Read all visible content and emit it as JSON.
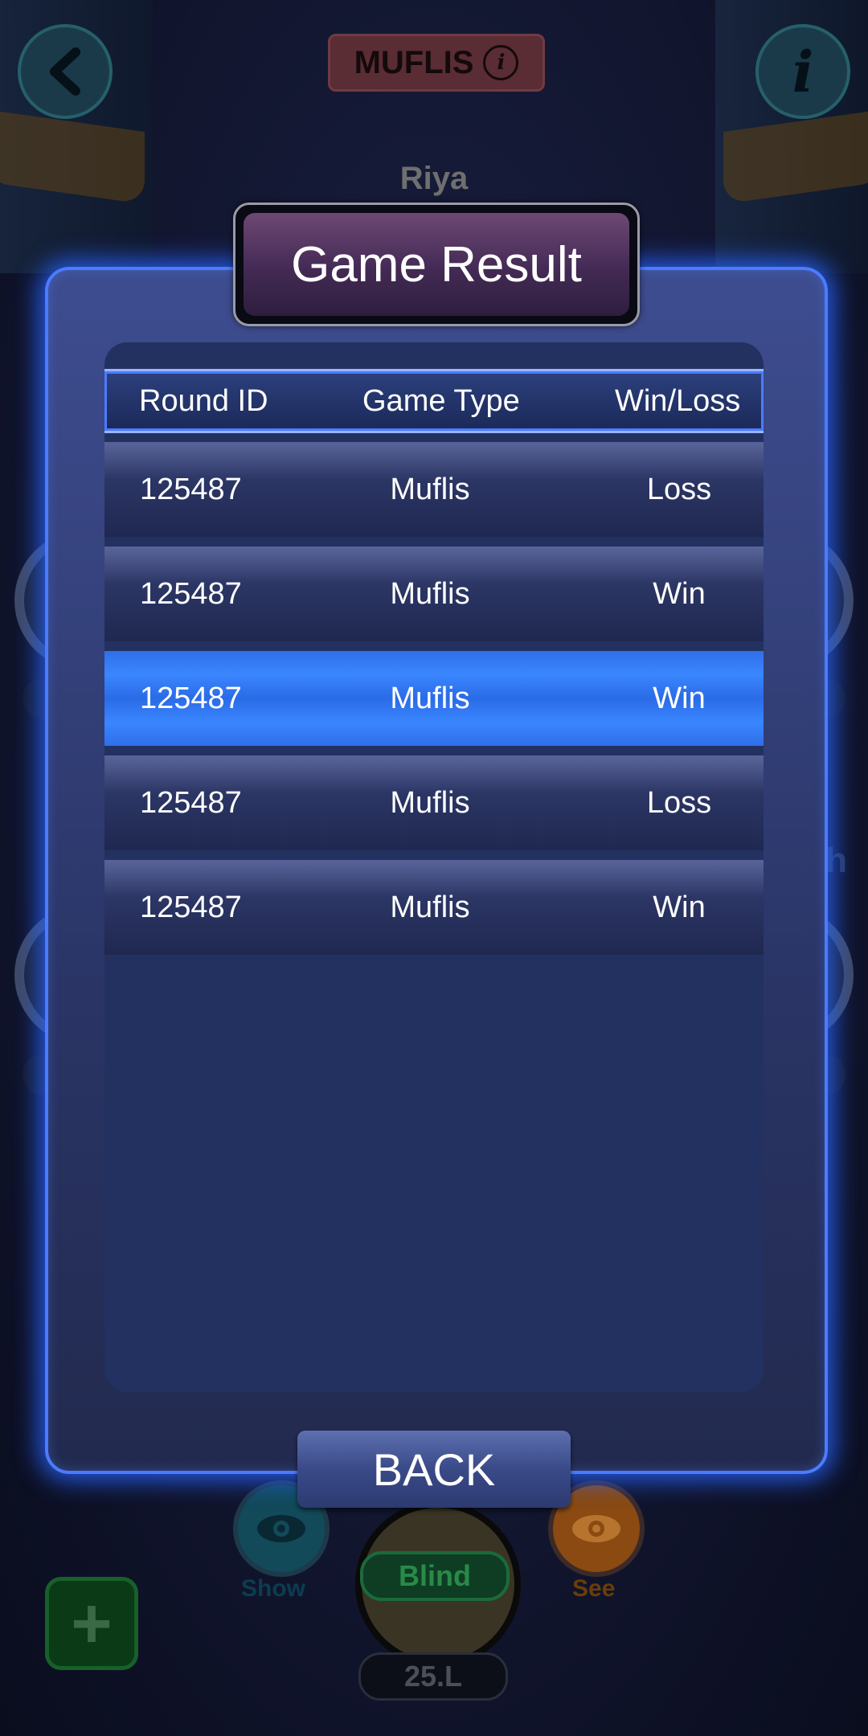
{
  "table": {
    "mode_label": "MUFLIS",
    "player_name": "Riya",
    "side_char": "h",
    "show_label": "Show",
    "see_label": "See",
    "blind_label": "Blind",
    "amount": "25.L",
    "plus_label": "+"
  },
  "modal": {
    "title": "Game Result",
    "columns": [
      "Round ID",
      "Game Type",
      "Win/Loss"
    ],
    "rows": [
      {
        "round_id": "125487",
        "game_type": "Muflis",
        "result": "Loss",
        "highlighted": false
      },
      {
        "round_id": "125487",
        "game_type": "Muflis",
        "result": "Win",
        "highlighted": false
      },
      {
        "round_id": "125487",
        "game_type": "Muflis",
        "result": "Win",
        "highlighted": true
      },
      {
        "round_id": "125487",
        "game_type": "Muflis",
        "result": "Loss",
        "highlighted": false
      },
      {
        "round_id": "125487",
        "game_type": "Muflis",
        "result": "Win",
        "highlighted": false
      }
    ],
    "back_label": "BACK"
  },
  "icons": [
    "back-arrow-icon",
    "info-icon",
    "eye-icon",
    "plus-icon"
  ],
  "colors": {
    "accent": "#4b7cff",
    "highlight_row": "#3a86ff",
    "modal_bg": "#2a3566"
  }
}
